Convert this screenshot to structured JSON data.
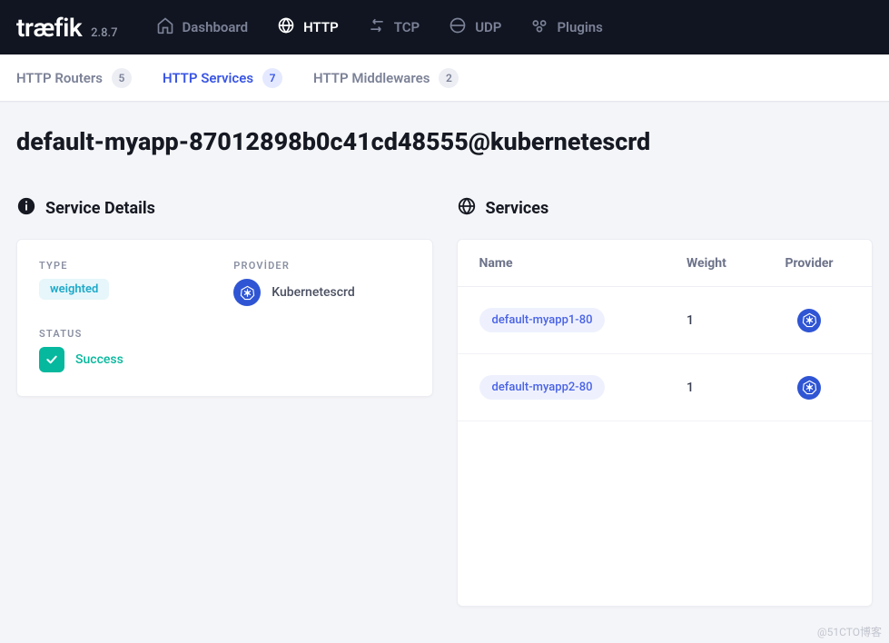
{
  "brand": {
    "name": "træfik",
    "version": "2.8.7"
  },
  "nav": {
    "items": [
      {
        "id": "dashboard",
        "label": "Dashboard",
        "active": false
      },
      {
        "id": "http",
        "label": "HTTP",
        "active": true
      },
      {
        "id": "tcp",
        "label": "TCP",
        "active": false
      },
      {
        "id": "udp",
        "label": "UDP",
        "active": false
      },
      {
        "id": "plugins",
        "label": "Plugins",
        "active": false
      }
    ]
  },
  "subnav": {
    "tabs": [
      {
        "id": "routers",
        "label": "HTTP Routers",
        "count": "5",
        "active": false
      },
      {
        "id": "services",
        "label": "HTTP Services",
        "count": "7",
        "active": true
      },
      {
        "id": "middlewares",
        "label": "HTTP Middlewares",
        "count": "2",
        "active": false
      }
    ]
  },
  "page": {
    "title": "default-myapp-87012898b0c41cd48555@kubernetescrd"
  },
  "details": {
    "section_title": "Service Details",
    "type_label": "TYPE",
    "type_value": "weighted",
    "provider_label": "PROVİDER",
    "provider_value": "Kubernetescrd",
    "status_label": "STATUS",
    "status_value": "Success"
  },
  "services": {
    "section_title": "Services",
    "columns": {
      "name": "Name",
      "weight": "Weight",
      "provider": "Provider"
    },
    "rows": [
      {
        "name": "default-myapp1-80",
        "weight": "1",
        "provider": "kubernetescrd"
      },
      {
        "name": "default-myapp2-80",
        "weight": "1",
        "provider": "kubernetescrd"
      }
    ]
  },
  "watermark": "@51CTO博客"
}
